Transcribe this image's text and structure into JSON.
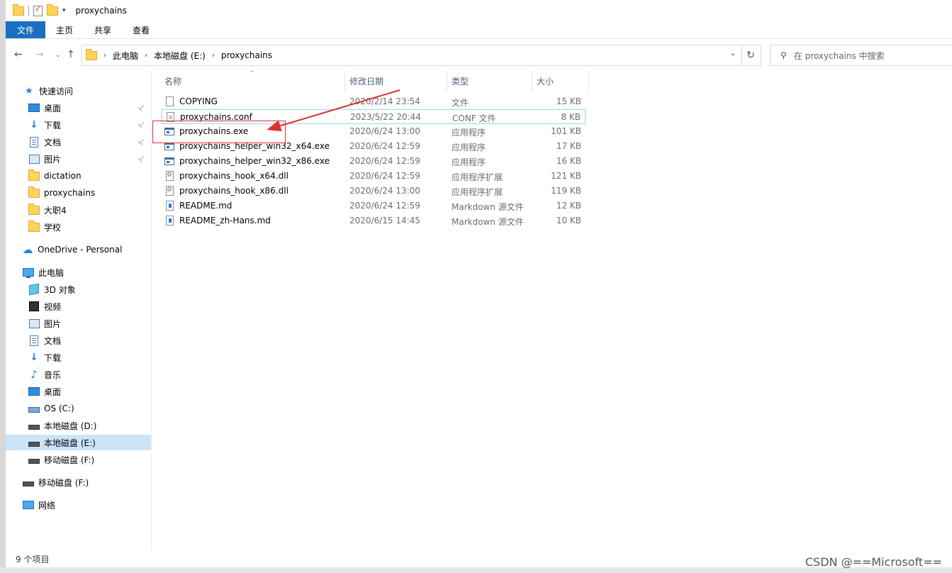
{
  "window": {
    "title": "proxychains"
  },
  "ribbon": {
    "tabs": [
      "文件",
      "主页",
      "共享",
      "查看"
    ]
  },
  "address": {
    "crumbs": [
      "此电脑",
      "本地磁盘 (E:)",
      "proxychains"
    ],
    "search_placeholder": "在 proxychains 中搜索"
  },
  "nav": {
    "quick_access": "快速访问",
    "items": [
      {
        "label": "桌面",
        "icon": "desktop-icon",
        "pinned": true
      },
      {
        "label": "下载",
        "icon": "download-icon",
        "pinned": true
      },
      {
        "label": "文档",
        "icon": "document-icon",
        "pinned": true
      },
      {
        "label": "图片",
        "icon": "picture-icon",
        "pinned": true
      },
      {
        "label": "dictation",
        "icon": "folder-icon"
      },
      {
        "label": "proxychains",
        "icon": "folder-icon"
      },
      {
        "label": "大职4",
        "icon": "folder-icon"
      },
      {
        "label": "学校",
        "icon": "folder-icon"
      }
    ],
    "onedrive": "OneDrive - Personal",
    "this_pc": "此电脑",
    "pc_items": [
      {
        "label": "3D 对象",
        "icon": "3d-objects-icon"
      },
      {
        "label": "视频",
        "icon": "video-icon"
      },
      {
        "label": "图片",
        "icon": "picture-icon"
      },
      {
        "label": "文档",
        "icon": "document-icon"
      },
      {
        "label": "下载",
        "icon": "download-icon"
      },
      {
        "label": "音乐",
        "icon": "music-icon"
      },
      {
        "label": "桌面",
        "icon": "desktop-icon"
      },
      {
        "label": "OS (C:)",
        "icon": "os-drive-icon"
      },
      {
        "label": "本地磁盘 (D:)",
        "icon": "drive-icon"
      },
      {
        "label": "本地磁盘 (E:)",
        "icon": "drive-icon",
        "selected": true
      },
      {
        "label": "移动磁盘 (F:)",
        "icon": "drive-icon"
      }
    ],
    "removable": "移动磁盘 (F:)",
    "network": "网络"
  },
  "columns": {
    "name": "名称",
    "date": "修改日期",
    "type": "类型",
    "size": "大小"
  },
  "files": [
    {
      "name": "COPYING",
      "date": "2020/2/14 23:54",
      "type": "文件",
      "size": "15 KB",
      "icon": "plain"
    },
    {
      "name": "proxychains.conf",
      "date": "2023/5/22 20:44",
      "type": "CONF 文件",
      "size": "8 KB",
      "icon": "conf"
    },
    {
      "name": "proxychains.exe",
      "date": "2020/6/24 13:00",
      "type": "应用程序",
      "size": "101 KB",
      "icon": "exe"
    },
    {
      "name": "proxychains_helper_win32_x64.exe",
      "date": "2020/6/24 12:59",
      "type": "应用程序",
      "size": "17 KB",
      "icon": "exe"
    },
    {
      "name": "proxychains_helper_win32_x86.exe",
      "date": "2020/6/24 12:59",
      "type": "应用程序",
      "size": "16 KB",
      "icon": "exe"
    },
    {
      "name": "proxychains_hook_x64.dll",
      "date": "2020/6/24 12:59",
      "type": "应用程序扩展",
      "size": "121 KB",
      "icon": "dll"
    },
    {
      "name": "proxychains_hook_x86.dll",
      "date": "2020/6/24 13:00",
      "type": "应用程序扩展",
      "size": "119 KB",
      "icon": "dll"
    },
    {
      "name": "README.md",
      "date": "2020/6/24 12:59",
      "type": "Markdown 源文件",
      "size": "12 KB",
      "icon": "md"
    },
    {
      "name": "README_zh-Hans.md",
      "date": "2020/6/15 14:45",
      "type": "Markdown 源文件",
      "size": "10 KB",
      "icon": "md"
    }
  ],
  "status": {
    "count": "9 个项目"
  },
  "watermark": "CSDN @==Microsoft==",
  "colors": {
    "accent": "#1a6fc0",
    "annotation": "#e03030",
    "selection": "#cce4f7"
  }
}
